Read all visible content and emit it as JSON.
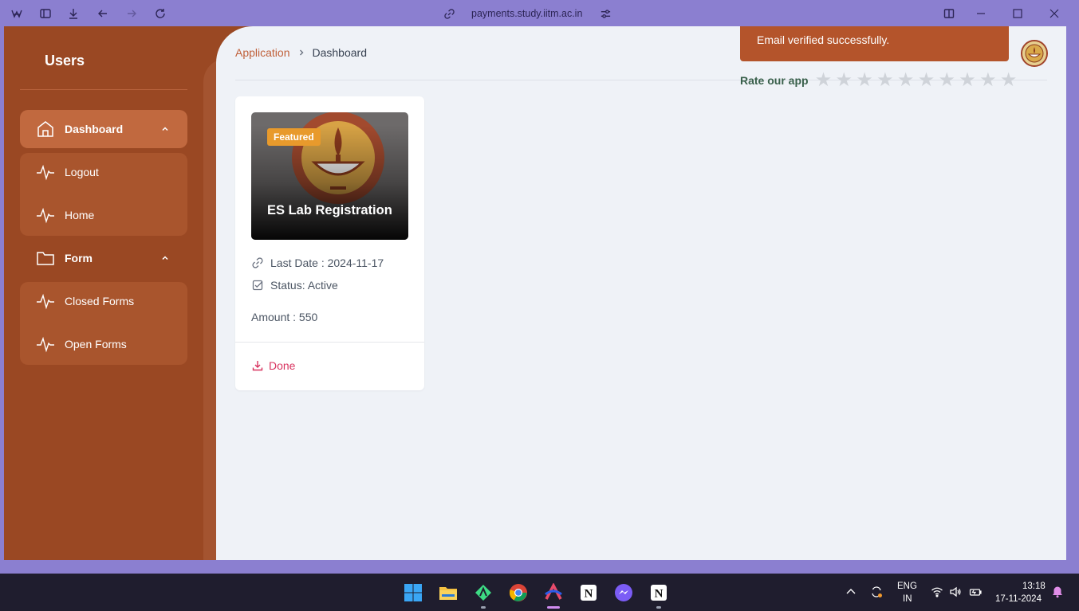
{
  "browser": {
    "url": "payments.study.iitm.ac.in",
    "icons": [
      "workspaces-icon",
      "sidebar-toggle-icon",
      "downloads-icon",
      "back-icon",
      "forward-icon",
      "reload-icon",
      "link-icon",
      "site-settings-icon",
      "split-view-icon",
      "minimize-icon",
      "maximize-icon",
      "close-icon"
    ]
  },
  "sidebar": {
    "title": "Users",
    "items": [
      {
        "label": "Dashboard",
        "icon": "home-icon",
        "active": true,
        "expanded": true
      },
      {
        "label": "Logout",
        "icon": "activity-icon"
      },
      {
        "label": "Home",
        "icon": "activity-icon"
      },
      {
        "label": "Form",
        "icon": "folder-icon",
        "expanded": true
      },
      {
        "label": "Closed Forms",
        "icon": "activity-icon"
      },
      {
        "label": "Open Forms",
        "icon": "activity-icon"
      }
    ]
  },
  "breadcrumb": {
    "parent": "Application",
    "current": "Dashboard"
  },
  "toast": {
    "message": "Email verified successfully."
  },
  "rating": {
    "label": "Rate our app",
    "max_stars": 10,
    "value": 0
  },
  "card": {
    "badge": "Featured",
    "title": "ES Lab Registration",
    "last_date": "Last Date : 2024-11-17",
    "status": "Status: Active",
    "amount": "Amount : 550",
    "action": "Done"
  },
  "taskbar": {
    "apps": [
      "windows-start-icon",
      "file-explorer-icon",
      "android-studio-icon",
      "chrome-icon",
      "arc-browser-icon",
      "notion-icon",
      "messenger-icon",
      "notion-icon"
    ],
    "lang_top": "ENG",
    "lang_bottom": "IN",
    "time": "13:18",
    "date": "17-11-2024"
  },
  "colors": {
    "sidebar": "#9a4823",
    "accent": "#c0603a",
    "toast": "#b4542b",
    "badge": "#e89a2c",
    "done": "#d8335f",
    "browser_frame": "#8b7fd0"
  }
}
